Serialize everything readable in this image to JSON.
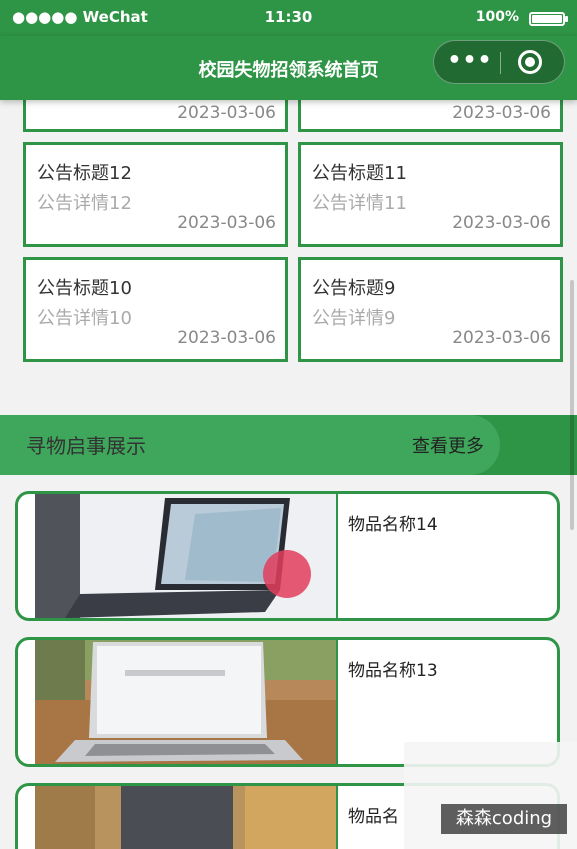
{
  "status_bar": {
    "carrier": "●●●●● WeChat",
    "time": "11:30",
    "battery": "100%"
  },
  "nav": {
    "title": "校园失物招领系统首页",
    "more_glyph": "•••"
  },
  "notices": [
    {
      "title": "",
      "detail": "",
      "date": "2023-03-06"
    },
    {
      "title": "",
      "detail": "",
      "date": "2023-03-06"
    },
    {
      "title": "公告标题12",
      "detail": "公告详情12",
      "date": "2023-03-06"
    },
    {
      "title": "公告标题11",
      "detail": "公告详情11",
      "date": "2023-03-06"
    },
    {
      "title": "公告标题10",
      "detail": "公告详情10",
      "date": "2023-03-06"
    },
    {
      "title": "公告标题9",
      "detail": "公告详情9",
      "date": "2023-03-06"
    }
  ],
  "section": {
    "title": "寻物启事展示",
    "more": "查看更多"
  },
  "items": [
    {
      "name": "物品名称14"
    },
    {
      "name": "物品名称13"
    },
    {
      "name": "物品名"
    }
  ],
  "watermark": "森森coding",
  "colors": {
    "primary": "#2e9446",
    "band": "#3fa75b",
    "card_border": "#2e9446"
  }
}
